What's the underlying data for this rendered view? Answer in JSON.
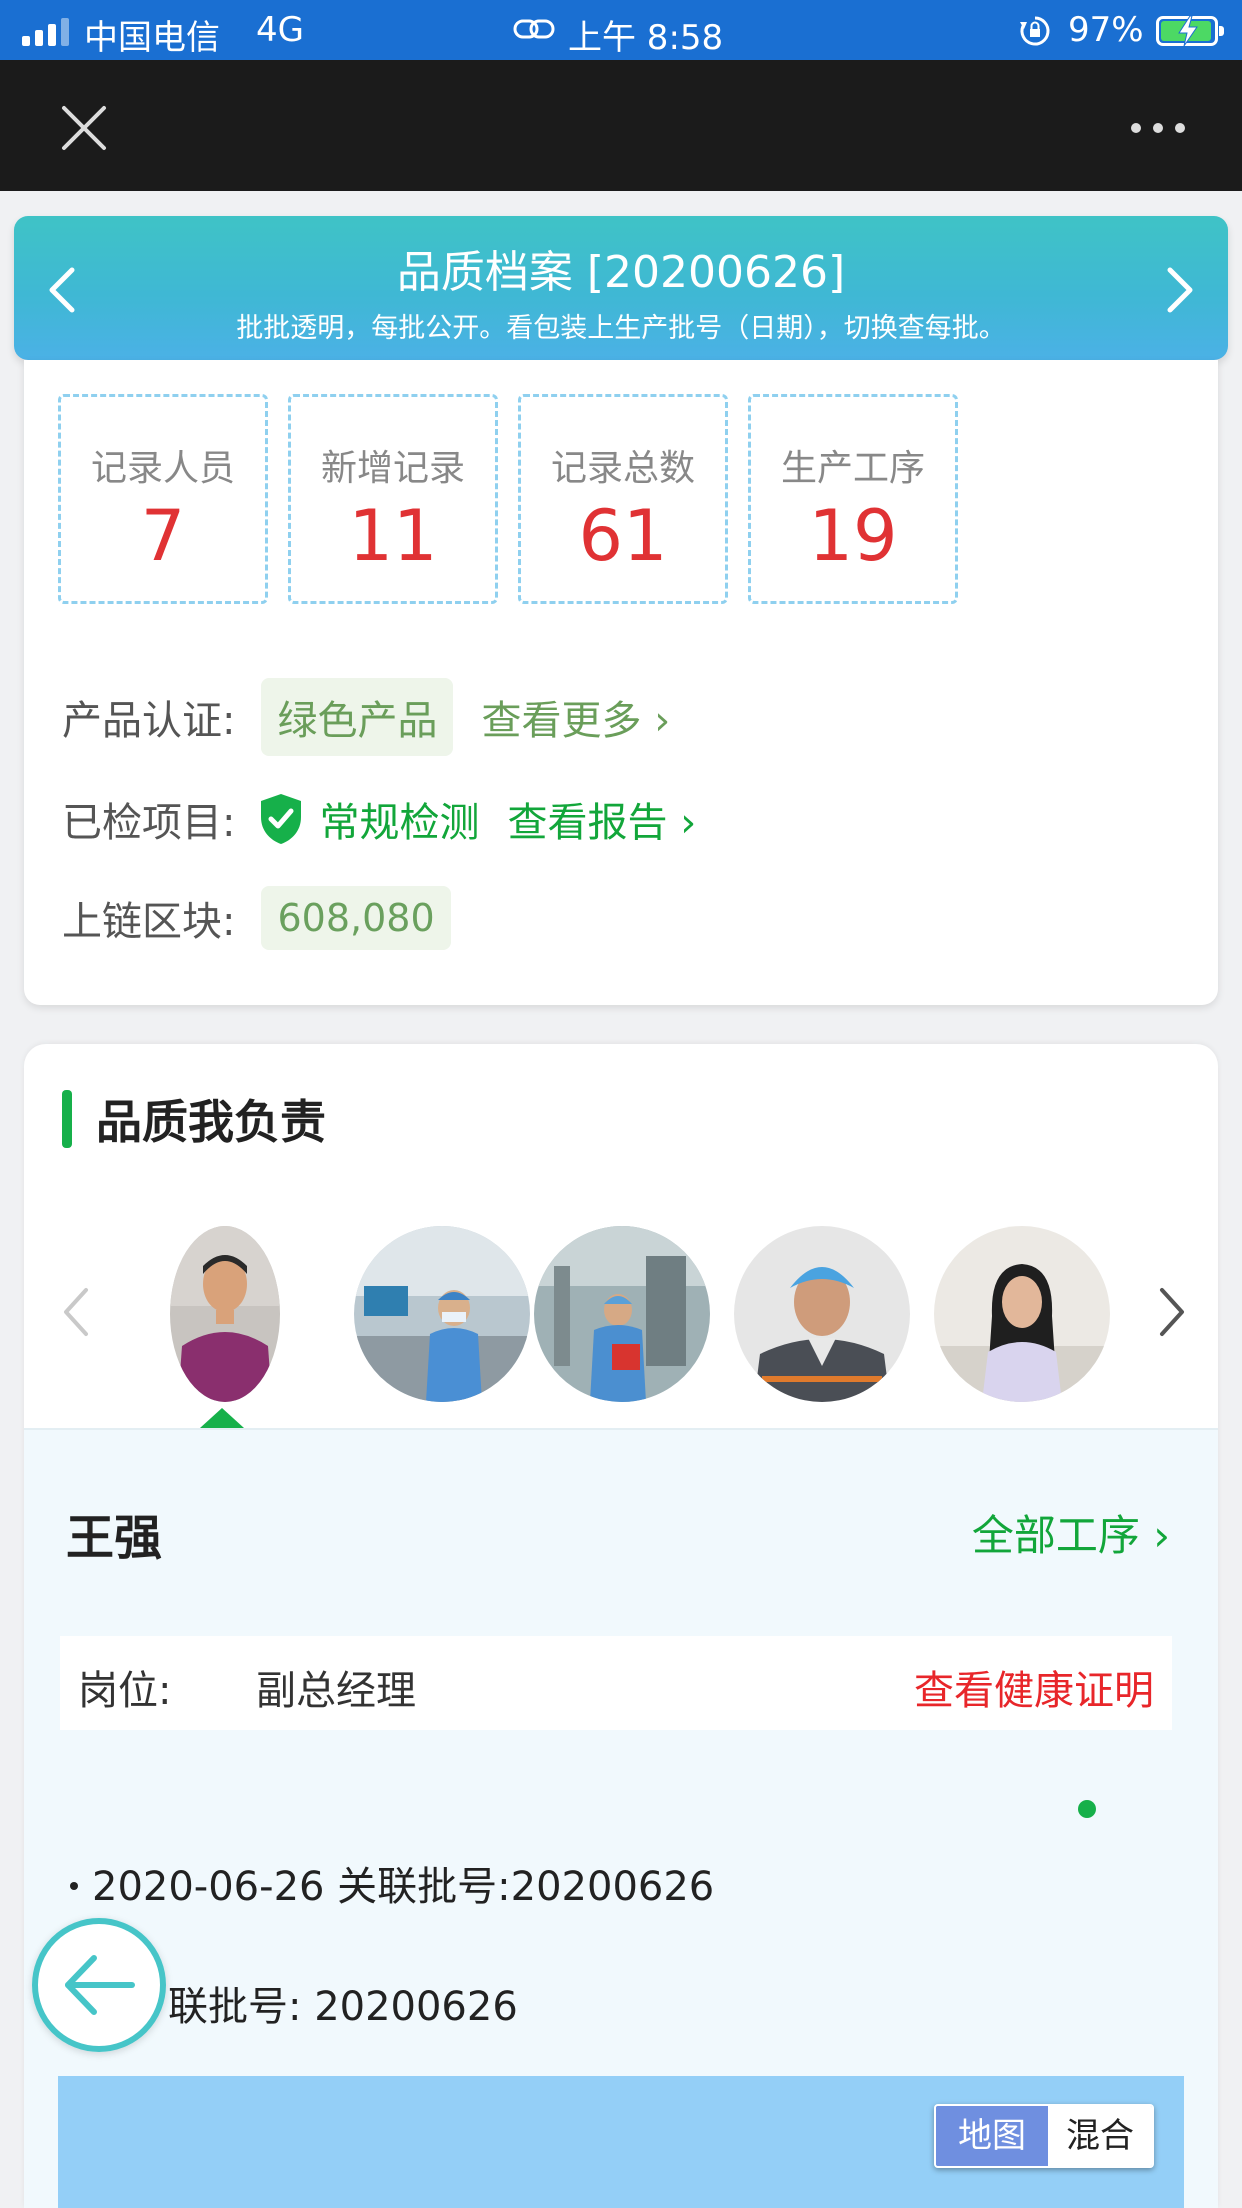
{
  "status_bar": {
    "carrier": "中国电信",
    "network": "4G",
    "time": "上午 8:58",
    "battery_percent": "97%",
    "battery_level": 0.97,
    "signal_bars": 3
  },
  "banner": {
    "title": "品质档案 [20200626]",
    "subtitle": "批批透明，每批公开。看包装上生产批号（日期），切换查每批。"
  },
  "stats": [
    {
      "label": "记录人员",
      "value": "7"
    },
    {
      "label": "新增记录",
      "value": "11"
    },
    {
      "label": "记录总数",
      "value": "61"
    },
    {
      "label": "生产工序",
      "value": "19"
    }
  ],
  "info": {
    "cert_label": "产品认证:",
    "cert_tag": "绿色产品",
    "cert_more": "查看更多 ›",
    "inspect_label": "已检项目:",
    "inspect_value": "常规检测",
    "inspect_link": "查看报告 ›",
    "chain_label": "上链区块:",
    "chain_value": "608,080"
  },
  "quality": {
    "section_title": "品质我负责",
    "person_name": "王强",
    "all_steps": "全部工序 ›",
    "position_label": "岗位:",
    "position_value": "副总经理",
    "health_link": "查看健康证明",
    "record_line": "2020-06-26  关联批号:20200626",
    "batch_line": "联批号:  20200626",
    "map_toggle": {
      "map": "地图",
      "hybrid": "混合"
    }
  },
  "colors": {
    "status_bar": "#1a6fd2",
    "accent_green": "#16b04a",
    "stat_red": "#e03234",
    "health_red": "#e8262a",
    "banner": "#3fbdcc"
  }
}
